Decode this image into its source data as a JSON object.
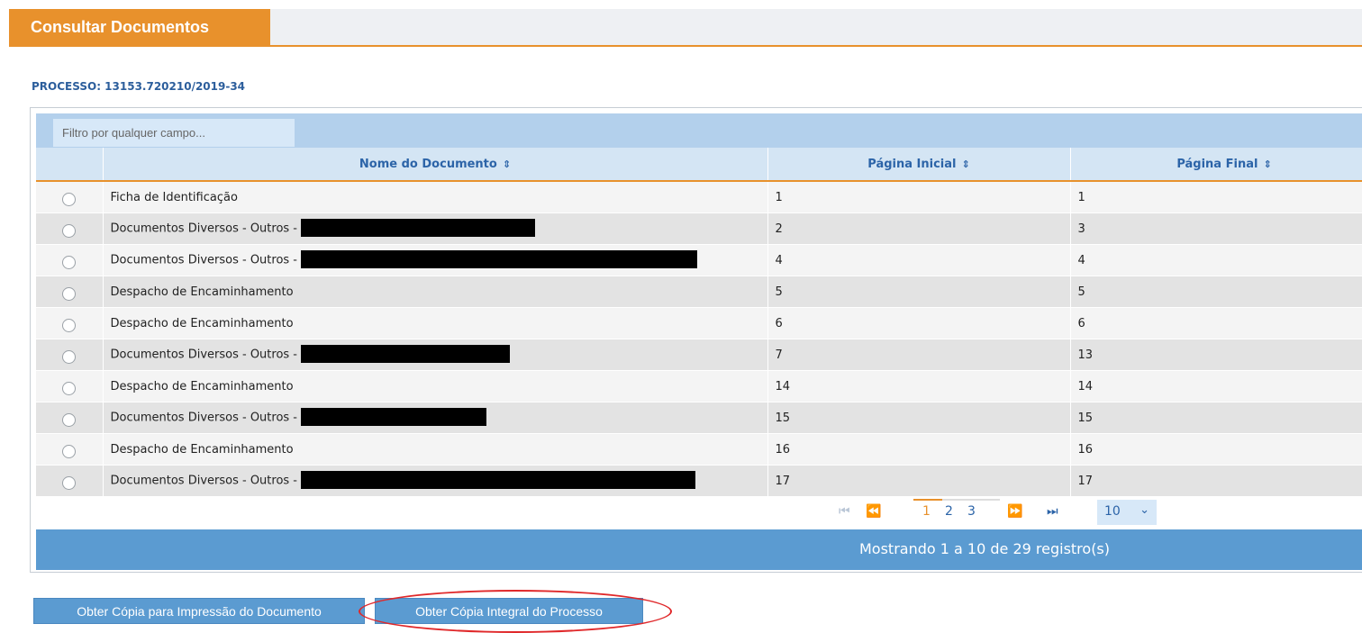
{
  "tab": {
    "title": "Consultar Documentos"
  },
  "processo": {
    "label": "PROCESSO: 13153.720210/2019-34"
  },
  "filter": {
    "placeholder": "Filtro por qualquer campo..."
  },
  "table": {
    "columns": [
      "Nome do Documento",
      "Página Inicial",
      "Página Final"
    ],
    "sort_icon": "sort-icon",
    "rows": [
      {
        "name": "Ficha de Identificação",
        "start": "1",
        "end": "1",
        "redacted": false
      },
      {
        "name": "Documentos Diversos - Outros -",
        "start": "2",
        "end": "3",
        "redacted": true
      },
      {
        "name": "Documentos Diversos - Outros -",
        "start": "4",
        "end": "4",
        "redacted": true
      },
      {
        "name": "Despacho de Encaminhamento",
        "start": "5",
        "end": "5",
        "redacted": false
      },
      {
        "name": "Despacho de Encaminhamento",
        "start": "6",
        "end": "6",
        "redacted": false
      },
      {
        "name": "Documentos Diversos - Outros -",
        "start": "7",
        "end": "13",
        "redacted": true
      },
      {
        "name": "Despacho de Encaminhamento",
        "start": "14",
        "end": "14",
        "redacted": false
      },
      {
        "name": "Documentos Diversos - Outros -",
        "start": "15",
        "end": "15",
        "redacted": true
      },
      {
        "name": "Despacho de Encaminhamento",
        "start": "16",
        "end": "16",
        "redacted": false
      },
      {
        "name": "Documentos Diversos - Outros -",
        "start": "17",
        "end": "17",
        "redacted": true
      }
    ]
  },
  "pager": {
    "pages": [
      "1",
      "2",
      "3"
    ],
    "current_page": "1",
    "first_icon": "first-page-icon",
    "prev_icon": "prev-page-icon",
    "next_icon": "next-page-icon",
    "last_icon": "last-page-icon",
    "page_size": "10"
  },
  "status": {
    "text": "Mostrando 1 a 10 de 29 registro(s)"
  },
  "buttons": {
    "print_copy": "Obter Cópia para Impressão do Documento",
    "full_copy": "Obter Cópia Integral do Processo"
  },
  "colors": {
    "accent_orange": "#e8912c",
    "header_blue": "#2c64a8",
    "bar_blue": "#5b9bd1",
    "highlight_red": "#e0282a"
  }
}
